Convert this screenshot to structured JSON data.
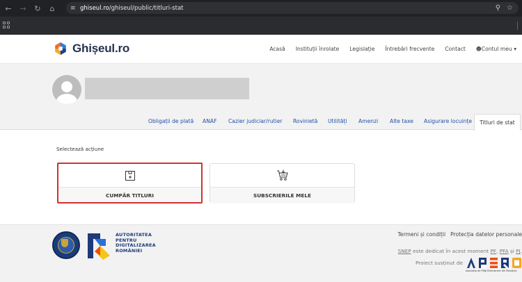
{
  "browser": {
    "url_host": "ghiseul.ro",
    "url_path": "/ghiseul/public/titluri-stat"
  },
  "site": {
    "logo_text": "Ghișeul.ro",
    "nav": [
      {
        "label": "Acasă"
      },
      {
        "label": "Instituții înrolate"
      },
      {
        "label": "Legislație"
      },
      {
        "label": "Întrebări frecvente"
      },
      {
        "label": "Contact"
      },
      {
        "label": "Contul meu"
      }
    ]
  },
  "tabs": {
    "items": [
      {
        "label": "Obligații de plată"
      },
      {
        "label": "ANAF"
      },
      {
        "label": "Cazier judiciar/rutier"
      },
      {
        "label": "Rovinietă"
      },
      {
        "label": "Utilități"
      },
      {
        "label": "Amenzi"
      },
      {
        "label": "Alte taxe"
      },
      {
        "label": "Asigurare locuințe"
      }
    ],
    "active": "Titluri de stat"
  },
  "content": {
    "select_label": "Selectează acțiune",
    "cards": [
      {
        "label": "CUMPĂR TITLURI",
        "icon": "package-icon",
        "selected": true
      },
      {
        "label": "SUBSCRIERILE MELE",
        "icon": "shopping-cart-icon",
        "selected": false
      }
    ]
  },
  "footer": {
    "adr_lines": [
      "AUTORITATEA",
      "PENTRU",
      "DIGITALIZAREA",
      "ROMÂNIEI"
    ],
    "links": [
      {
        "label": "Termeni și condiții"
      },
      {
        "label": "Protecția datelor personale"
      }
    ],
    "snep_prefix": "SNEP",
    "snep_middle": " este dedicat în acest moment ",
    "snep_pf": "PF",
    "snep_sep1": ", ",
    "snep_pfa": "PFA",
    "snep_sep2": " și ",
    "snep_pj": "PJ",
    "snep_end": ".",
    "proiect": "Proiect susținut de",
    "apero_caption": "Asociația de Plăți Electronice din România"
  },
  "colors": {
    "accent_blue": "#1f4fa8",
    "highlight_red": "#d32f2f",
    "logo_navy": "#25324d"
  }
}
